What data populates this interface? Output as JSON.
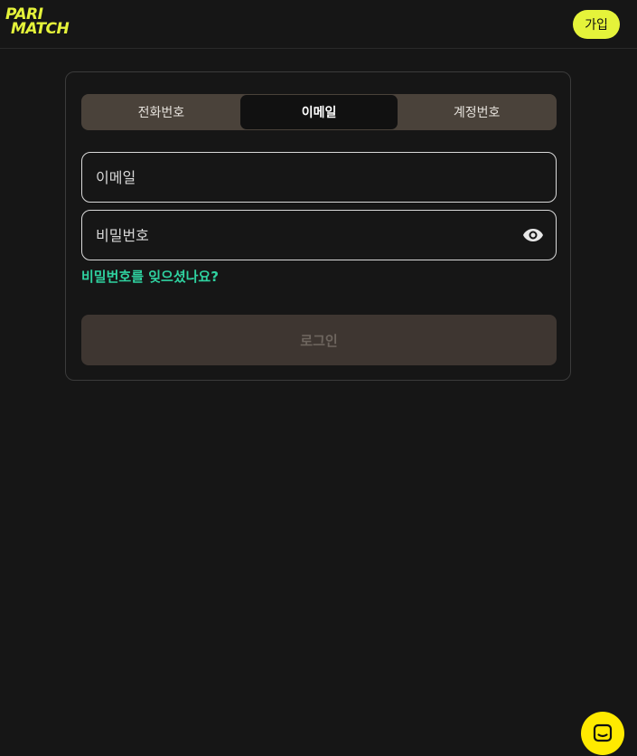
{
  "header": {
    "logo_line1": "PARI",
    "logo_line2": "MATCH",
    "signup_label": "가입"
  },
  "tabs": [
    {
      "label": "전화번호",
      "active": false
    },
    {
      "label": "이메일",
      "active": true
    },
    {
      "label": "계정번호",
      "active": false
    }
  ],
  "form": {
    "email_placeholder": "이메일",
    "password_placeholder": "비밀번호",
    "forgot_label": "비밀번호를 잊으셨나요?",
    "login_label": "로그인"
  },
  "icons": {
    "password_toggle": "eye-icon",
    "chat": "chat-icon"
  },
  "colors": {
    "brand_yellow": "#e5f33a",
    "link_green": "#2fd2a0",
    "chat_yellow": "#ffea00"
  }
}
